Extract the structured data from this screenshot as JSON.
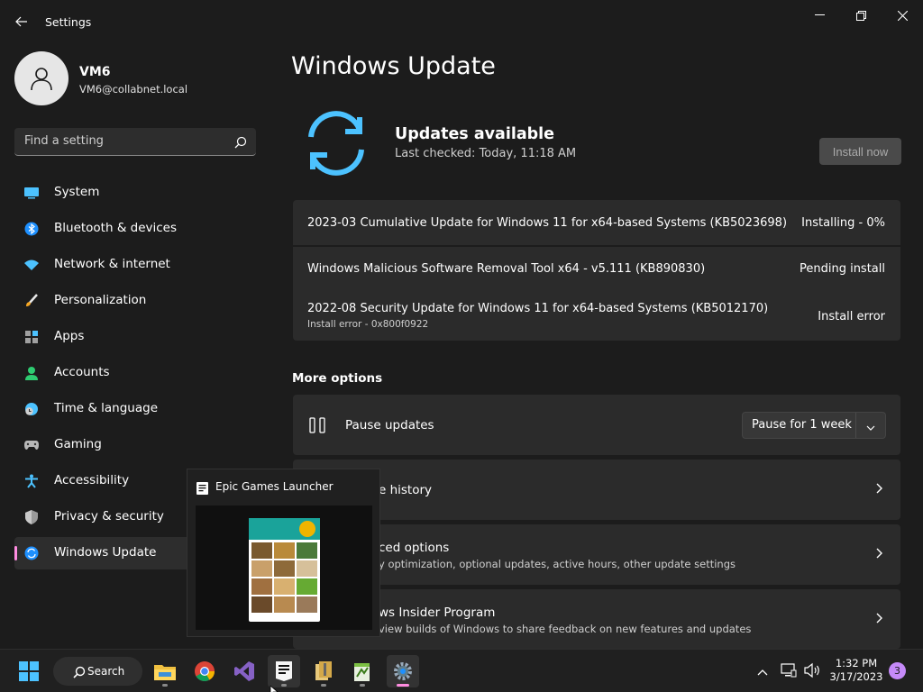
{
  "window": {
    "title": "Settings",
    "minimize_icon": "minimize-icon",
    "maximize_icon": "restore-icon",
    "close_icon": "close-icon"
  },
  "user": {
    "name": "VM6",
    "email": "VM6@collabnet.local"
  },
  "search": {
    "placeholder": "Find a setting"
  },
  "nav": {
    "items": [
      {
        "label": "System",
        "icon": "system-icon"
      },
      {
        "label": "Bluetooth & devices",
        "icon": "bluetooth-icon"
      },
      {
        "label": "Network & internet",
        "icon": "wifi-icon"
      },
      {
        "label": "Personalization",
        "icon": "brush-icon"
      },
      {
        "label": "Apps",
        "icon": "apps-icon"
      },
      {
        "label": "Accounts",
        "icon": "person-icon"
      },
      {
        "label": "Time & language",
        "icon": "clock-globe-icon"
      },
      {
        "label": "Gaming",
        "icon": "gamepad-icon"
      },
      {
        "label": "Accessibility",
        "icon": "accessibility-icon"
      },
      {
        "label": "Privacy & security",
        "icon": "shield-icon"
      },
      {
        "label": "Windows Update",
        "icon": "sync-icon",
        "selected": true
      }
    ]
  },
  "main": {
    "title": "Windows Update",
    "status": "Updates available",
    "last_checked": "Last checked: Today, 11:18 AM",
    "install_button": "Install now",
    "updates": [
      {
        "name": "2023-03 Cumulative Update for Windows 11 for x64-based Systems (KB5023698)",
        "status": "Installing - 0%"
      },
      {
        "name": "Windows Malicious Software Removal Tool x64 - v5.111 (KB890830)",
        "status": "Pending install"
      },
      {
        "name": "2022-08 Security Update for Windows 11 for x64-based Systems (KB5012170)",
        "status": "Install error",
        "detail": "Install error - 0x800f0922"
      }
    ],
    "more_options": "More options",
    "pause": {
      "label": "Pause updates",
      "value": "Pause for 1 week"
    },
    "options": [
      {
        "title": "e history"
      },
      {
        "title": "ced options",
        "desc": "y optimization, optional updates, active hours, other update settings"
      },
      {
        "title": "ws Insider Program",
        "desc": "view builds of Windows to share feedback on new features and updates"
      }
    ]
  },
  "popup": {
    "title": "Epic Games Launcher",
    "icon": "epic-games-icon"
  },
  "taskbar": {
    "search_label": "Search",
    "apps": [
      "windows-start-icon",
      "file-explorer-icon",
      "chrome-icon",
      "visual-studio-icon",
      "epic-games-icon",
      "archive-icon",
      "notepad-plus-plus-icon",
      "settings-gear-icon"
    ],
    "time": "1:32 PM",
    "date": "3/17/2023",
    "notification_count": "3"
  },
  "colors": {
    "accent": "#ff8ce0",
    "update_blue": "#4cc2ff",
    "background": "#1c1c1c",
    "card": "#2b2b2b"
  }
}
